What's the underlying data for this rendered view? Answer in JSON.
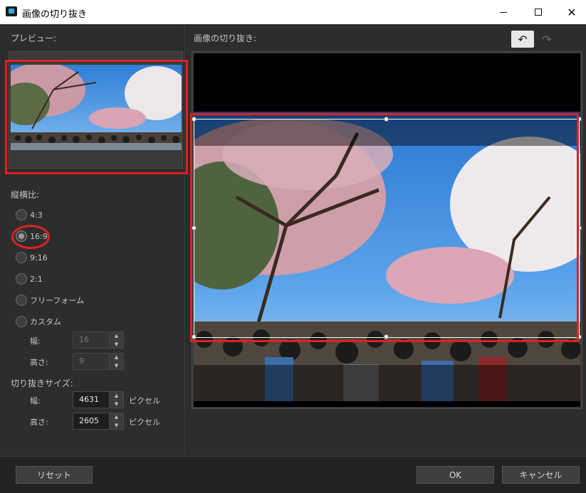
{
  "window": {
    "title": "画像の切り抜き",
    "minimize_icon": "minimize-icon",
    "maximize_icon": "maximize-icon",
    "close_glyph": "✕"
  },
  "preview": {
    "label": "プレビュー:"
  },
  "aspect": {
    "label": "縦横比:",
    "options": [
      {
        "label": "4:3",
        "checked": false
      },
      {
        "label": "16:9",
        "checked": true
      },
      {
        "label": "9:16",
        "checked": false
      },
      {
        "label": "2:1",
        "checked": false
      },
      {
        "label": "フリーフォーム",
        "checked": false
      },
      {
        "label": "カスタム",
        "checked": false
      }
    ],
    "custom_width_label": "幅:",
    "custom_width_value": "16",
    "custom_height_label": "高さ:",
    "custom_height_value": "9"
  },
  "crop_size": {
    "label": "切り抜きサイズ:",
    "width_label": "幅:",
    "width_value": "4631",
    "height_label": "高さ:",
    "height_value": "2605",
    "unit": "ピクセル"
  },
  "editor": {
    "label": "画像の切り抜き:",
    "undo_glyph": "↶",
    "redo_glyph": "↷"
  },
  "footer": {
    "reset_label": "リセット",
    "ok_label": "OK",
    "cancel_label": "キャンセル"
  },
  "colors": {
    "highlight": "#e02020",
    "sky": "#3f8fe0",
    "blossom": "#e6b7c3"
  }
}
